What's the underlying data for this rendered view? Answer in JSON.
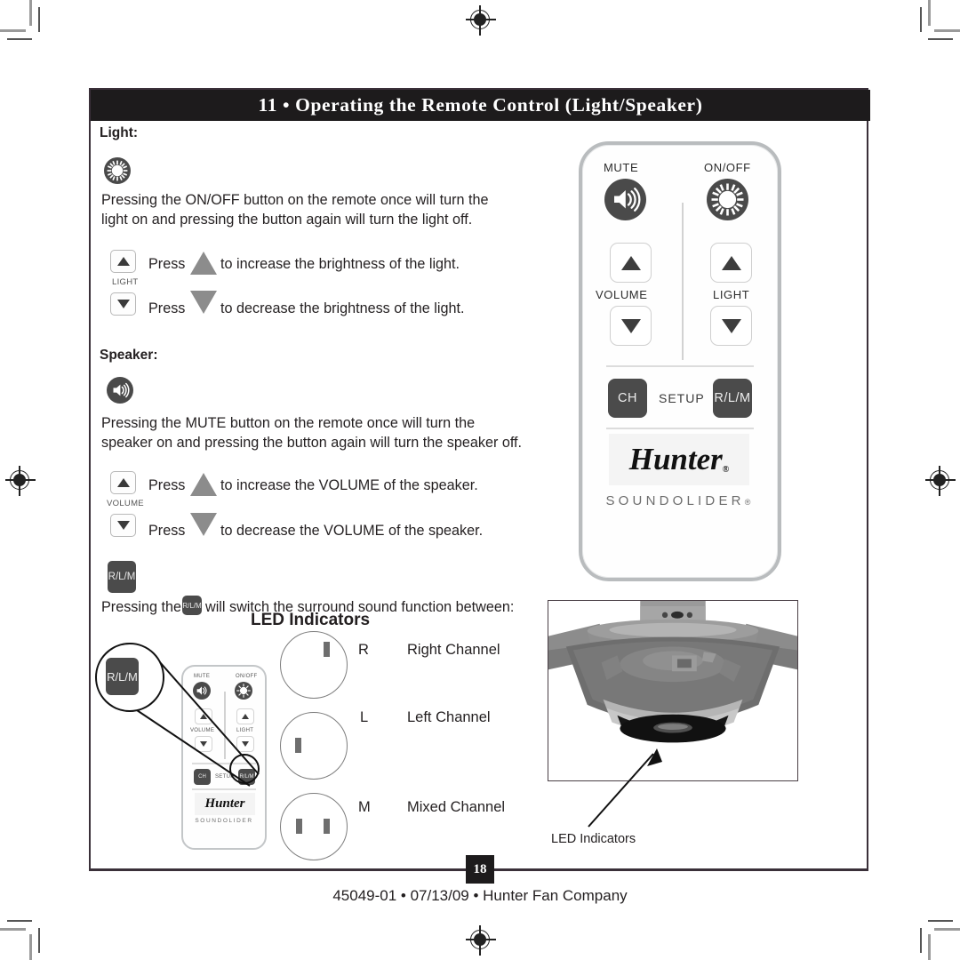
{
  "header": {
    "title": "11 • Operating the Remote Control (Light/Speaker)"
  },
  "sections": {
    "light": {
      "label": "Light:",
      "icon": "sun-icon",
      "paragraph": "Pressing the ON/OFF button on the remote once will turn the\nlight on and pressing the button again will turn the light off.",
      "keycap_group_label": "LIGHT",
      "rows": [
        {
          "press": "Press",
          "triangle": "triangle-up",
          "text": "to increase the brightness of the light."
        },
        {
          "press": "Press",
          "triangle": "triangle-down",
          "text": "to decrease the brightness of the light."
        }
      ]
    },
    "speaker": {
      "label": "Speaker:",
      "icon": "speaker-icon",
      "paragraph": "Pressing the MUTE button on the remote once will turn the\nspeaker on and pressing the button again will turn the speaker off.",
      "keycap_group_label": "VOLUME",
      "rows": [
        {
          "press": "Press",
          "triangle": "triangle-up",
          "text": "to increase the VOLUME of the speaker."
        },
        {
          "press": "Press",
          "triangle": "triangle-down",
          "text": "to decrease the VOLUME of the speaker."
        }
      ]
    },
    "rlm": {
      "key_label": "R/L/M",
      "sentence_before": "Pressing the",
      "inline_key_label": "R/L/M",
      "sentence_after": "will switch the surround sound function between:"
    }
  },
  "led_indicators": {
    "heading": "LED Indicators",
    "items": [
      {
        "letter": "R",
        "name": "Right Channel",
        "lights": 1,
        "position": "right"
      },
      {
        "letter": "L",
        "name": "Left  Channel",
        "lights": 1,
        "position": "left"
      },
      {
        "letter": "M",
        "name": "Mixed Channel",
        "lights": 2,
        "position": "both"
      }
    ]
  },
  "remote_big": {
    "labels": {
      "mute": "MUTE",
      "onoff": "ON/OFF",
      "volume": "VOLUME",
      "light": "LIGHT",
      "ch": "CH",
      "setup": "SETUP",
      "rlm": "R/L/M"
    },
    "brand": "Hunter",
    "brand_mark": "®",
    "product": "SOUNDOLIDER",
    "product_mark": "®"
  },
  "remote_small": {
    "labels": {
      "mute": "MUTE",
      "onoff": "ON/OFF",
      "volume": "VOLUME",
      "light": "LIGHT",
      "ch": "CH",
      "setup": "SETUP",
      "rlm": "R/L/M"
    },
    "brand": "Hunter",
    "product": "SOUNDOLIDER",
    "callout_key_label": "R/L/M"
  },
  "photo": {
    "caption": "LED Indicators",
    "alt": "ceiling-fan-light-housing-photo"
  },
  "footer": {
    "page_number": "18",
    "text": "45049-01  •  07/13/09  •  Hunter Fan Company"
  },
  "colors": {
    "header_bg": "#1d1b1c",
    "border": "#3a3039",
    "dark_key": "#4b4b4b",
    "triangle_grey": "#8c8c8c",
    "text": "#231f20"
  }
}
